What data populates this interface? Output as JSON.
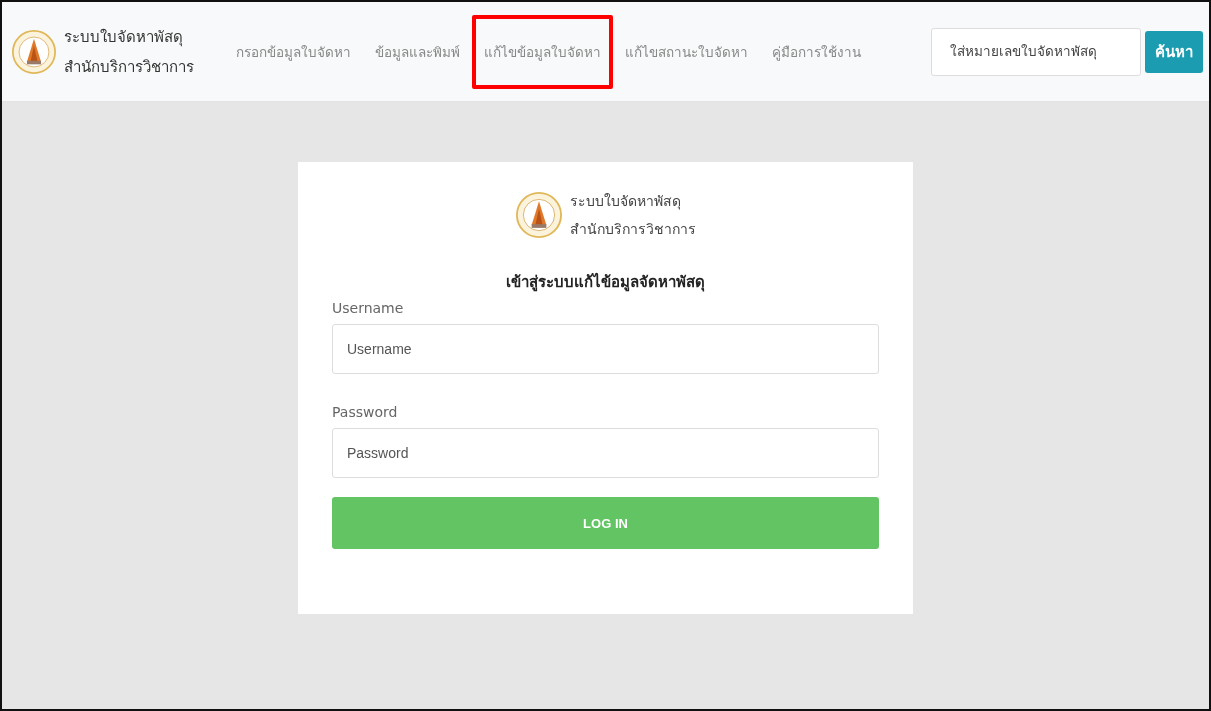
{
  "brand": {
    "line_1": "ระบบใบจัดหาพัสดุ",
    "line_2": "สำนักบริการวิชาการ"
  },
  "nav": [
    {
      "label": "กรอกข้อมูลใบจัดหา",
      "highlighted": false
    },
    {
      "label": "ข้อมูลและพิมพ์",
      "highlighted": false
    },
    {
      "label": "แก้ไขข้อมูลใบจัดหา",
      "highlighted": true
    },
    {
      "label": "แก้ไขสถานะใบจัดหา",
      "highlighted": false
    },
    {
      "label": "คู่มือการใช้งาน",
      "highlighted": false
    }
  ],
  "search": {
    "placeholder": "ใส่หมายเลขใบจัดหาพัสดุ",
    "button": "ค้นหา"
  },
  "login": {
    "brand_line_1": "ระบบใบจัดหาพัสดุ",
    "brand_line_2": "สำนักบริการวิชาการ",
    "heading": "เข้าสู่ระบบแก้ไข้อมูลจัดหาพัสดุ",
    "fields": [
      {
        "label": "Username",
        "placeholder": "Username"
      },
      {
        "label": "Password",
        "placeholder": "Password"
      }
    ],
    "button": "LOG IN"
  }
}
